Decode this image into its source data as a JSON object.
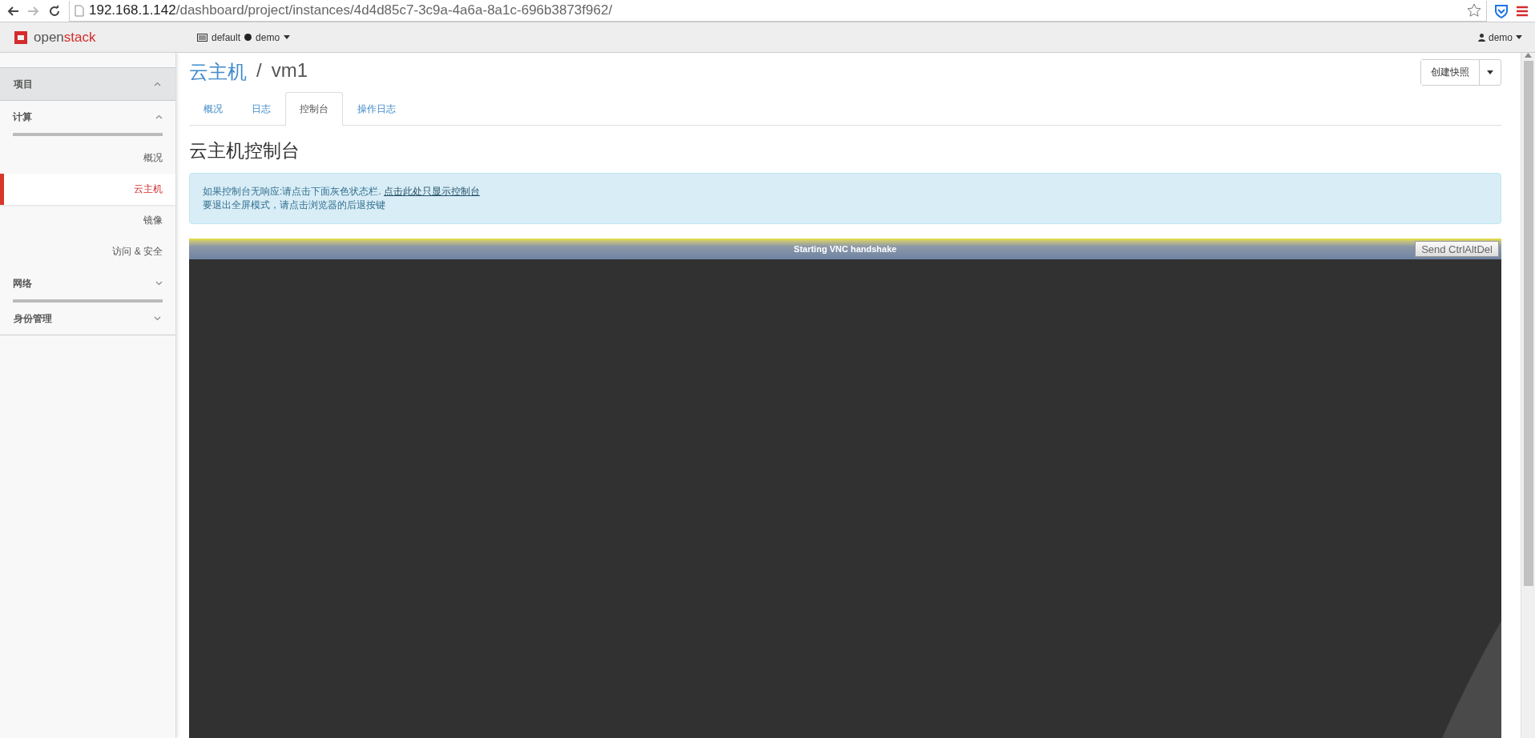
{
  "browser": {
    "url_host": "192.168.1.142",
    "url_path": "/dashboard/project/instances/4d4d85c7-3c9a-4a6a-8a1c-696b3873f962/"
  },
  "topbar": {
    "logo_words": [
      "open",
      "stack"
    ],
    "domain": "default",
    "project": "demo",
    "user": "demo"
  },
  "sidebar": {
    "dashboards": [
      {
        "label": "项目",
        "expanded": true,
        "groups": [
          {
            "label": "计算",
            "expanded": true,
            "items": [
              {
                "label": "概况",
                "selected": false
              },
              {
                "label": "云主机",
                "selected": true
              },
              {
                "label": "镜像",
                "selected": false
              },
              {
                "label": "访问 & 安全",
                "selected": false
              }
            ]
          },
          {
            "label": "网络",
            "expanded": false
          }
        ]
      },
      {
        "label": "身份管理",
        "expanded": false
      }
    ]
  },
  "page": {
    "breadcrumb": {
      "parent": "云主机",
      "separator": "/",
      "current": "vm1"
    },
    "action_button": "创建快照",
    "tabs": [
      {
        "label": "概况",
        "selected": false
      },
      {
        "label": "日志",
        "selected": false
      },
      {
        "label": "控制台",
        "selected": true
      },
      {
        "label": "操作日志",
        "selected": false
      }
    ],
    "heading": "云主机控制台",
    "alert": {
      "line_1": "如果控制台无响应:请点击下面灰色状态栏.",
      "link": "点击此处只显示控制台",
      "line_2": "要退出全屏模式，请点击浏览器的后退按键"
    },
    "console": {
      "status": "Starting VNC handshake",
      "button": "Send CtrlAltDel"
    }
  }
}
